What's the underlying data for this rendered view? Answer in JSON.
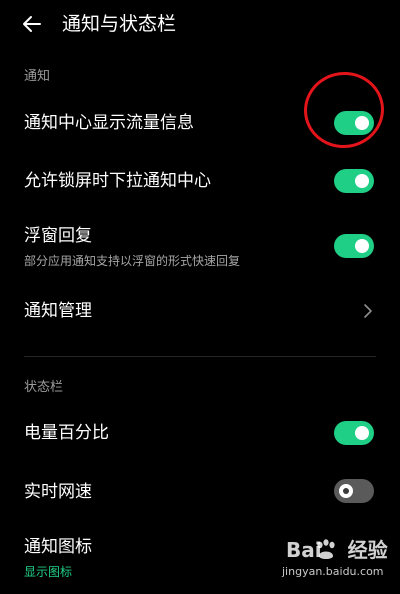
{
  "header": {
    "back_icon": "back-arrow-icon",
    "title": "通知与状态栏"
  },
  "sections": {
    "notifications": {
      "label": "通知",
      "items": [
        {
          "title": "通知中心显示流量信息",
          "toggle": "on"
        },
        {
          "title": "允许锁屏时下拉通知中心",
          "toggle": "on"
        },
        {
          "title": "浮窗回复",
          "subtitle": "部分应用通知支持以浮窗的形式快速回复",
          "toggle": "on"
        },
        {
          "title": "通知管理",
          "control": "chevron-right-icon"
        }
      ]
    },
    "status_bar": {
      "label": "状态栏",
      "items": [
        {
          "title": "电量百分比",
          "toggle": "on"
        },
        {
          "title": "实时网速",
          "toggle": "off"
        },
        {
          "title": "通知图标",
          "subtitle": "显示图标"
        }
      ]
    }
  },
  "colors": {
    "accent": "#1fcf86",
    "toggle_off": "#5a5a5a",
    "annotation": "#e3141a",
    "background": "#000000"
  },
  "watermark": {
    "brand_left": "Bai",
    "brand_right": "经验",
    "url": "jingyan.baidu.com"
  }
}
